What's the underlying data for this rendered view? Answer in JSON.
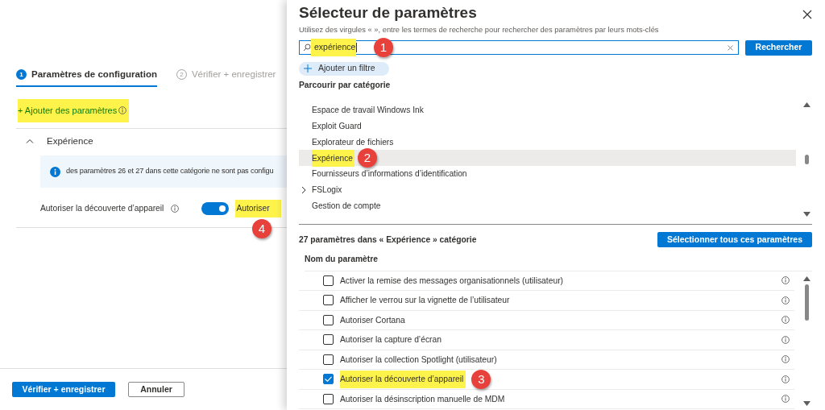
{
  "wizard_tabs": [
    {
      "number": "1",
      "label": "Paramètres de configuration",
      "selected": true
    },
    {
      "number": "2",
      "label": "Vérifier + enregistrer",
      "selected": false
    }
  ],
  "add_settings_link": {
    "label": "+ Ajouter des paramètres",
    "highlighted": true
  },
  "section": {
    "title": "Expérience",
    "expanded": true,
    "info": "des paramètres 26 et 27 dans cette catégorie ne sont pas configu",
    "setting": {
      "label": "Autoriser la découverte d’appareil",
      "on": true,
      "value": "Autoriser",
      "highlighted": true,
      "callout": "4"
    }
  },
  "footer_buttons": [
    {
      "label": "Vérifier + enregistrer",
      "kind": "primary"
    },
    {
      "label": "Annuler",
      "kind": "secondary"
    }
  ],
  "picker": {
    "title": "Sélecteur de paramètres",
    "hint": "Utilisez des virgules « », entre les termes de recherche pour rechercher des paramètres par leurs mots-clés",
    "search": {
      "value": "expérience",
      "highlighted": true,
      "callout": "1"
    },
    "search_button": "Rechercher",
    "add_filter": "Ajouter un filtre",
    "browse_heading": "Parcourir par catégorie",
    "categories": [
      {
        "label": "Espace de travail Windows Ink",
        "selected": false,
        "expandable": false,
        "highlighted": false
      },
      {
        "label": "Exploit Guard",
        "selected": false,
        "expandable": false,
        "highlighted": false
      },
      {
        "label": "Explorateur de fichiers",
        "selected": false,
        "expandable": false,
        "highlighted": false
      },
      {
        "label": "Expérience",
        "selected": true,
        "expandable": false,
        "highlighted": true,
        "callout": "2"
      },
      {
        "label": "Fournisseurs d’informations d’identification",
        "selected": false,
        "expandable": false,
        "highlighted": false
      },
      {
        "label": "FSLogix",
        "selected": false,
        "expandable": true,
        "highlighted": false
      },
      {
        "label": "Gestion de compte",
        "selected": false,
        "expandable": false,
        "highlighted": false
      }
    ],
    "results_heading": "27 paramètres dans « Expérience » catégorie",
    "select_all": "Sélectionner tous ces paramètres",
    "column": "Nom du paramètre",
    "settings": [
      {
        "label": "Activer la remise des messages organisationnels (utilisateur)",
        "checked": false,
        "highlighted": false
      },
      {
        "label": "Afficher le verrou sur la vignette de l’utilisateur",
        "checked": false,
        "highlighted": false
      },
      {
        "label": "Autoriser Cortana",
        "checked": false,
        "highlighted": false
      },
      {
        "label": "Autoriser la capture d’écran",
        "checked": false,
        "highlighted": false
      },
      {
        "label": "Autoriser la collection Spotlight (utilisateur)",
        "checked": false,
        "highlighted": false
      },
      {
        "label": "Autoriser la découverte d’appareil",
        "checked": true,
        "highlighted": true,
        "callout": "3"
      },
      {
        "label": "Autoriser la désinscription manuelle de MDM",
        "checked": false,
        "highlighted": false
      }
    ]
  }
}
